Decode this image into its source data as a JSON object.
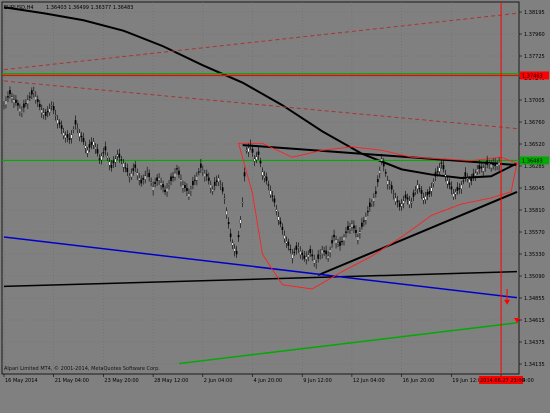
{
  "header": {
    "symbol": "EURUSD.H4",
    "ohlc": "1.36403 1.36499 1.36377 1.36483"
  },
  "footer": {
    "copyright": "Alpari Limited MT4, © 2001-2014, MetaQuotes Software Corp."
  },
  "chart_data": {
    "type": "candlestick",
    "instrument": "EURUSD",
    "timeframe": "H4",
    "y_axis": {
      "labels": [
        "1.38195",
        "1.37960",
        "1.37725",
        "1.37240",
        "1.37005",
        "1.36760",
        "1.36520",
        "1.36285",
        "1.36045",
        "1.35810",
        "1.35570",
        "1.35330",
        "1.35090",
        "1.34855",
        "1.34615",
        "1.34375",
        "1.34135"
      ],
      "highlight_labels": [
        {
          "text": "1.37463",
          "color": "#ff0000"
        },
        {
          "text": "1.36483",
          "color": "#00aa00"
        }
      ],
      "range": [
        1.34135,
        1.38195
      ]
    },
    "x_axis": {
      "labels": [
        "16 May 2014",
        "21 May 04:00",
        "23 May 20:00",
        "28 May 12:00",
        "2 Jun 04:00",
        "4 Jun 20:00",
        "9 Jun 12:00",
        "12 Jun 04:00",
        "16 Jun 20:00",
        "19 Jun 12:00",
        "24 Jun 04:00"
      ],
      "highlight_label": {
        "text": "2014.06.27 23:00",
        "color": "#ff0000"
      }
    },
    "close_path": [
      [
        0,
        1.3713
      ],
      [
        3,
        1.3725
      ],
      [
        6,
        1.3715
      ],
      [
        9,
        1.3705
      ],
      [
        12,
        1.3718
      ],
      [
        15,
        1.3728
      ],
      [
        18,
        1.371
      ],
      [
        21,
        1.37
      ],
      [
        24,
        1.3712
      ],
      [
        27,
        1.3695
      ],
      [
        30,
        1.368
      ],
      [
        33,
        1.3672
      ],
      [
        36,
        1.369
      ],
      [
        39,
        1.3675
      ],
      [
        42,
        1.366
      ],
      [
        45,
        1.367
      ],
      [
        48,
        1.365
      ],
      [
        51,
        1.366
      ],
      [
        54,
        1.364
      ],
      [
        57,
        1.3655
      ],
      [
        60,
        1.3645
      ],
      [
        63,
        1.363
      ],
      [
        66,
        1.364
      ],
      [
        69,
        1.3622
      ],
      [
        72,
        1.3635
      ],
      [
        75,
        1.3618
      ],
      [
        78,
        1.3628
      ],
      [
        81,
        1.3612
      ],
      [
        84,
        1.3625
      ],
      [
        87,
        1.3638
      ],
      [
        90,
        1.362
      ],
      [
        93,
        1.361
      ],
      [
        96,
        1.3625
      ],
      [
        99,
        1.364
      ],
      [
        102,
        1.363
      ],
      [
        105,
        1.3615
      ],
      [
        108,
        1.3628
      ],
      [
        111,
        1.3605
      ],
      [
        114,
        1.356
      ],
      [
        117,
        1.354
      ],
      [
        120,
        1.36
      ],
      [
        122,
        1.366
      ],
      [
        124,
        1.3665
      ],
      [
        126,
        1.365
      ],
      [
        128,
        1.3655
      ],
      [
        130,
        1.3635
      ],
      [
        133,
        1.362
      ],
      [
        136,
        1.36
      ],
      [
        139,
        1.3575
      ],
      [
        142,
        1.3555
      ],
      [
        145,
        1.354
      ],
      [
        148,
        1.3548
      ],
      [
        151,
        1.3535
      ],
      [
        154,
        1.3542
      ],
      [
        157,
        1.353
      ],
      [
        160,
        1.3545
      ],
      [
        163,
        1.3538
      ],
      [
        166,
        1.356
      ],
      [
        169,
        1.355
      ],
      [
        172,
        1.3565
      ],
      [
        175,
        1.3575
      ],
      [
        178,
        1.356
      ],
      [
        181,
        1.3578
      ],
      [
        184,
        1.3595
      ],
      [
        187,
        1.361
      ],
      [
        190,
        1.365
      ],
      [
        193,
        1.3625
      ],
      [
        196,
        1.361
      ],
      [
        199,
        1.3595
      ],
      [
        202,
        1.3605
      ],
      [
        205,
        1.36
      ],
      [
        208,
        1.362
      ],
      [
        211,
        1.3605
      ],
      [
        214,
        1.361
      ],
      [
        217,
        1.363
      ],
      [
        220,
        1.3645
      ],
      [
        223,
        1.3625
      ],
      [
        226,
        1.361
      ],
      [
        229,
        1.3615
      ],
      [
        232,
        1.363
      ],
      [
        235,
        1.3625
      ],
      [
        238,
        1.3638
      ],
      [
        241,
        1.364
      ],
      [
        244,
        1.3645
      ],
      [
        247,
        1.3642
      ],
      [
        250,
        1.3648
      ]
    ],
    "trendlines": [
      {
        "color": "#000000",
        "width": 2,
        "from": [
          120,
          1.3666
        ],
        "to": [
          258,
          1.3643
        ]
      },
      {
        "color": "#000000",
        "width": 2,
        "from": [
          158,
          1.3516
        ],
        "to": [
          258,
          1.3612
        ]
      },
      {
        "color": "#000000",
        "width": 1.5,
        "from": [
          0,
          1.3503
        ],
        "to": [
          258,
          1.352
        ]
      },
      {
        "color": "#0000cc",
        "width": 1.5,
        "from": [
          0,
          1.356
        ],
        "to": [
          258,
          1.349
        ]
      },
      {
        "color": "#00aa00",
        "width": 1.5,
        "from": [
          88,
          1.3414
        ],
        "to": [
          258,
          1.3461
        ]
      },
      {
        "color": "#aa3333",
        "width": 1,
        "dash": true,
        "from": [
          0,
          1.3753
        ],
        "to": [
          258,
          1.3818
        ]
      },
      {
        "color": "#aa3333",
        "width": 1,
        "dash": true,
        "from": [
          0,
          1.374
        ],
        "to": [
          258,
          1.3685
        ]
      }
    ],
    "horizontal_lines": [
      {
        "value": 1.37483,
        "color": "#00aa00"
      },
      {
        "value": 1.37463,
        "color": "#ff0000"
      },
      {
        "value": 1.36483,
        "color": "#00aa00"
      }
    ],
    "moving_average": [
      [
        0,
        1.3825
      ],
      [
        20,
        1.3818
      ],
      [
        40,
        1.381
      ],
      [
        60,
        1.3798
      ],
      [
        80,
        1.378
      ],
      [
        100,
        1.3758
      ],
      [
        120,
        1.3738
      ],
      [
        140,
        1.3712
      ],
      [
        160,
        1.3682
      ],
      [
        180,
        1.3656
      ],
      [
        200,
        1.3638
      ],
      [
        215,
        1.3632
      ],
      [
        230,
        1.3628
      ],
      [
        245,
        1.363
      ],
      [
        258,
        1.3645
      ]
    ],
    "channel_outline": [
      [
        118,
        1.3668
      ],
      [
        130,
        1.3668
      ],
      [
        145,
        1.3652
      ],
      [
        160,
        1.366
      ],
      [
        175,
        1.3664
      ],
      [
        190,
        1.366
      ],
      [
        205,
        1.3652
      ],
      [
        220,
        1.365
      ],
      [
        235,
        1.3648
      ],
      [
        250,
        1.3652
      ],
      [
        258,
        1.3645
      ],
      [
        255,
        1.3612
      ],
      [
        245,
        1.3605
      ],
      [
        230,
        1.3598
      ],
      [
        215,
        1.3585
      ],
      [
        200,
        1.356
      ],
      [
        185,
        1.3538
      ],
      [
        170,
        1.352
      ],
      [
        155,
        1.35
      ],
      [
        140,
        1.3505
      ],
      [
        130,
        1.354
      ],
      [
        125,
        1.361
      ],
      [
        118,
        1.3668
      ]
    ],
    "current_time_vline": {
      "bar": 250,
      "color": "#ff0000"
    },
    "projection_arrows": [
      {
        "from": [
          253,
          1.35
        ],
        "to": [
          253,
          1.3483
        ],
        "color": "#ff0000"
      },
      {
        "from": [
          258,
          1.3461
        ],
        "to": [
          258,
          1.3462
        ],
        "color": "#ff0000"
      }
    ]
  }
}
